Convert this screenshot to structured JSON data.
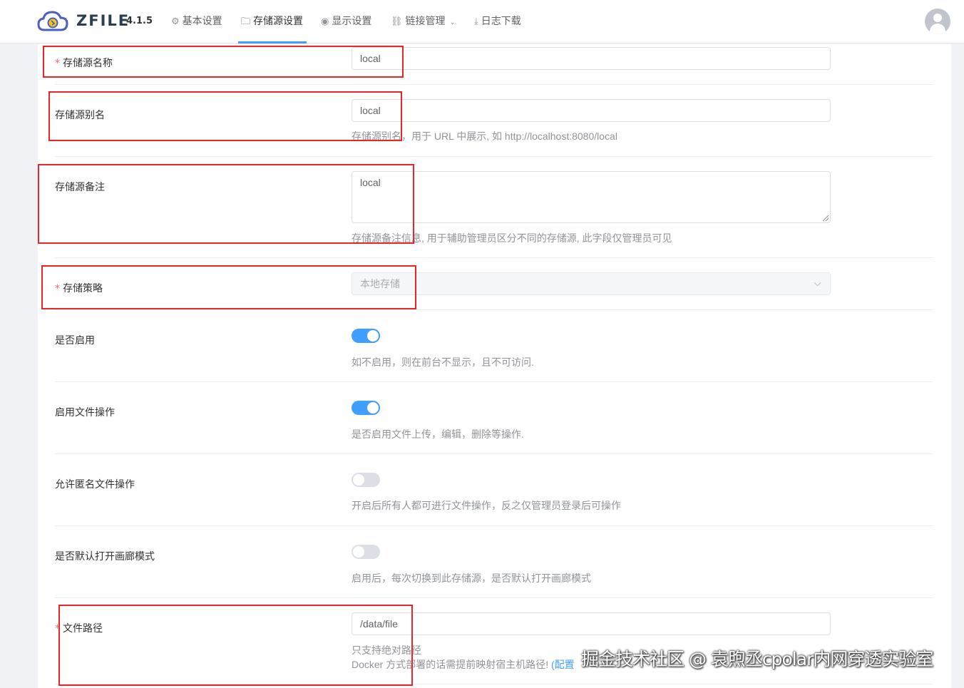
{
  "brand": {
    "name": "ZFILE",
    "version": "4.1.5"
  },
  "nav": {
    "items": [
      {
        "icon": "⚙",
        "label": "基本设置"
      },
      {
        "icon": "🗀",
        "label": "存储源设置"
      },
      {
        "icon": "◉",
        "label": "显示设置"
      },
      {
        "icon": "⛓",
        "label": "链接管理"
      },
      {
        "icon": "⤓",
        "label": "日志下载"
      }
    ],
    "active_index": 1
  },
  "form": {
    "name": {
      "label": "存储源名称",
      "required": "*",
      "value": "local"
    },
    "alias": {
      "label": "存储源别名",
      "value": "local",
      "help": "存储源别名，用于 URL 中展示, 如 http://localhost:8080/local"
    },
    "remark": {
      "label": "存储源备注",
      "value": "local",
      "help": "存储源备注信息, 用于辅助管理员区分不同的存储源, 此字段仅管理员可见"
    },
    "strategy": {
      "label": "存储策略",
      "required": "*",
      "value": "本地存储"
    },
    "enable": {
      "label": "是否启用",
      "on": true,
      "help": "如不启用，则在前台不显示，且不可访问."
    },
    "file_ops": {
      "label": "启用文件操作",
      "on": true,
      "help": "是否启用文件上传，编辑，删除等操作."
    },
    "anon_ops": {
      "label": "允许匿名文件操作",
      "on": false,
      "help": "开启后所有人都可进行文件操作，反之仅管理员登录后可操作"
    },
    "gallery": {
      "label": "是否默认打开画廊模式",
      "on": false,
      "help": "启用后，每次切换到此存储源，是否默认打开画廊模式"
    },
    "path": {
      "label": "文件路径",
      "required": "*",
      "value": "/data/file",
      "help1": "只支持绝对路径",
      "help2": "Docker 方式部署的话需提前映射宿主机路径!",
      "help2_link": "(配置"
    }
  },
  "watermark": "掘金技术社区 @ 袁煦丞cpolar内网穿透实验室",
  "colors": {
    "accent": "#409eff",
    "required": "#f56c6c",
    "annotation": "#e8262a"
  }
}
